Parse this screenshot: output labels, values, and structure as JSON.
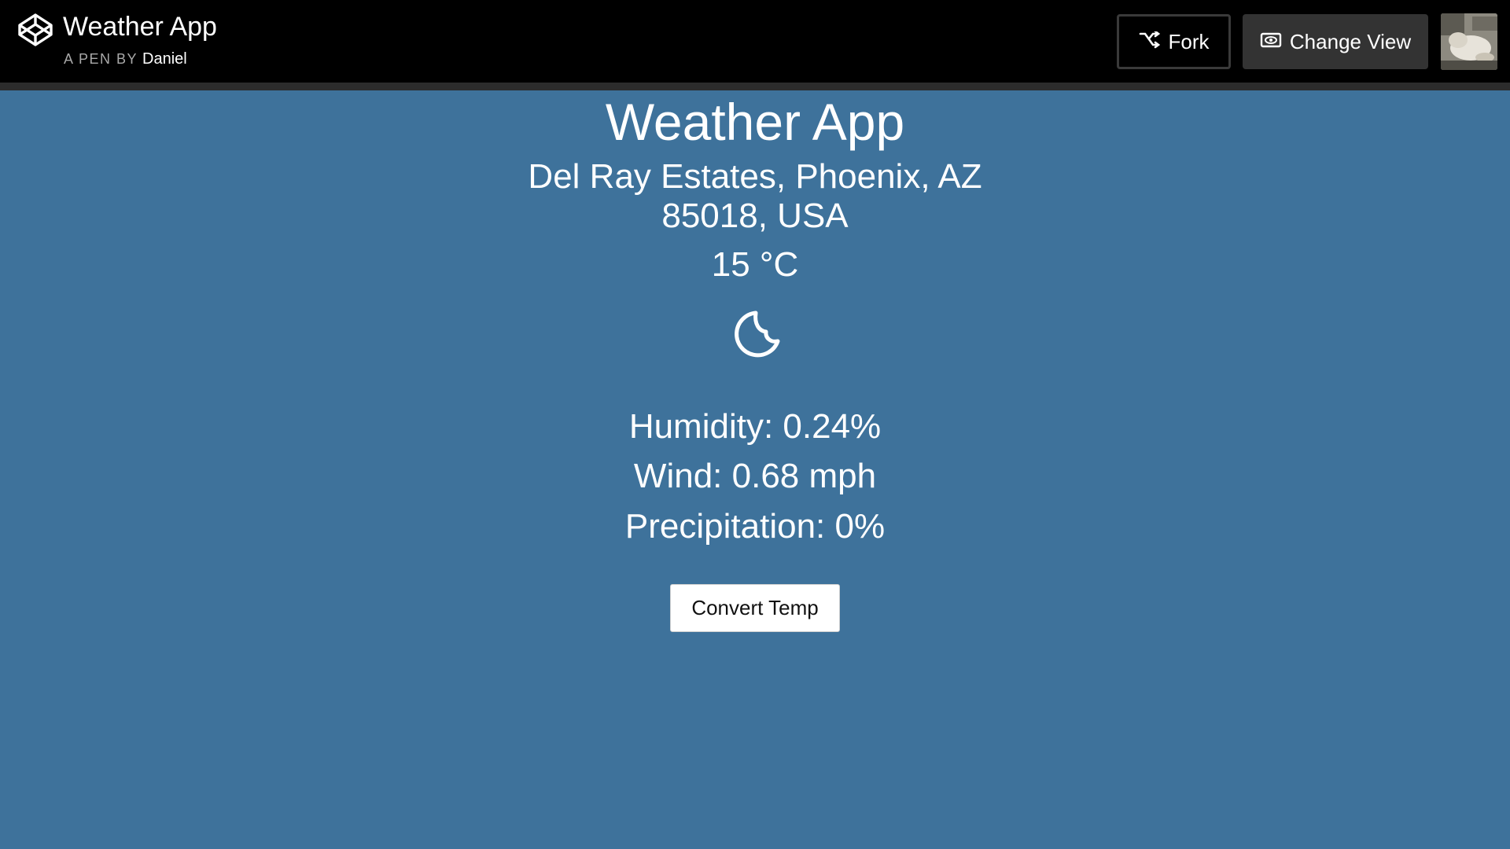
{
  "header": {
    "title": "Weather App",
    "by_prefix": "A PEN BY",
    "author": "Daniel",
    "logo_icon": "codepen-logo-icon",
    "fork_label": "Fork",
    "fork_icon": "fork-icon",
    "change_view_label": "Change View",
    "change_view_icon": "eye-icon"
  },
  "app": {
    "title": "Weather App",
    "location": "Del Ray Estates, Phoenix, AZ 85018, USA",
    "temperature": "15 °C",
    "condition_icon": "moon-icon",
    "humidity": "Humidity: 0.24%",
    "wind": "Wind: 0.68 mph",
    "precipitation": "Precipitation: 0%",
    "convert_label": "Convert Temp"
  },
  "colors": {
    "background": "#3e729b",
    "topbar": "#000000",
    "text": "#ffffff"
  }
}
